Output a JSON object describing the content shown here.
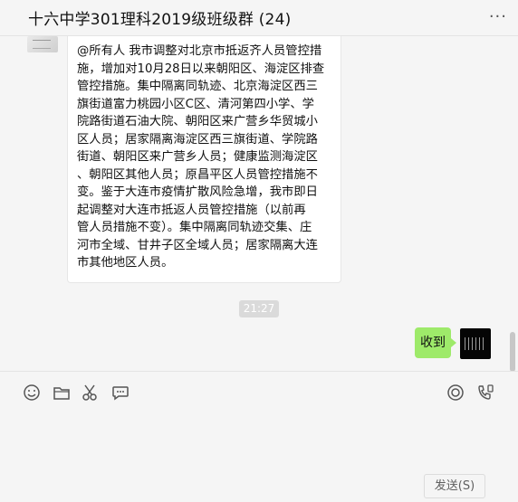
{
  "header": {
    "title": "十六中学301理科2019级班级群 (24)",
    "more_label": "···"
  },
  "messages": [
    {
      "side": "left",
      "text": "@所有人 我市调整对北京市抵返齐人员管控措\n施，增加对10月28日以来朝阳区、海淀区排查\n管控措施。集中隔离同轨迹、北京海淀区西三\n旗街道富力桃园小区C区、清河第四小学、学\n院路街道石油大院、朝阳区来广营乡华贸城小\n区人员；居家隔离海淀区西三旗街道、学院路\n街道、朝阳区来广营乡人员；健康监测海淀区\n、朝阳区其他人员；原昌平区人员管控措施不\n变。鉴于大连市疫情扩散风险急增，我市即日\n起调整对大连市抵返人员管控措施（以前再\n管人员措施不变）。集中隔离同轨迹交集、庄\n河市全域、甘井子区全域人员；居家隔离大连\n市其他地区人员。"
    },
    {
      "side": "right",
      "text": "收到"
    }
  ],
  "timestamp": "21:27",
  "composer": {
    "send_label": "发送(S)",
    "tools": [
      "emoji-icon",
      "folder-icon",
      "scissors-icon",
      "chat-bubble-icon",
      "live-icon",
      "phone-icon"
    ]
  },
  "colors": {
    "my_bubble": "#9eea6a",
    "background": "#f5f5f5"
  }
}
